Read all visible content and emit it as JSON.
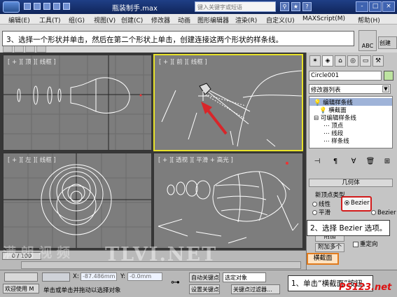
{
  "titlebar": {
    "title": "瓶装制手.max",
    "search_placeholder": "键入关键字或短语",
    "window_buttons": [
      "-",
      "□",
      "×"
    ]
  },
  "menu": [
    "编辑(E)",
    "工具(T)",
    "组(G)",
    "视图(V)",
    "创建(C)",
    "修改器",
    "动画",
    "图形编辑器",
    "渲染(R)",
    "自定义(U)",
    "MAXScript(M)",
    "帮助(H)"
  ],
  "caption": "3、选择一个形状并单击，然后在第二个形状上单击，创建连接这两个形状的样条线。",
  "toolbar": {
    "abc_label": "ABC",
    "create_label": "创建"
  },
  "viewports": {
    "top": "[ + ][ 顶 ][ 线框 ]",
    "front": "[ + ][ 前 ][ 线框 ]",
    "left": "[ + ][ 左 ][ 线框 ]",
    "perspective": "[ + ][ 透视 ][ 平滑 + 高光 ]"
  },
  "panel": {
    "object_name": "Circle001",
    "object_color": "#bde3a0",
    "modifier_list": "修改器列表",
    "stack": [
      "编辑样条线",
      "横截面",
      "可编辑样条线",
      "顶点",
      "线段",
      "样条线"
    ],
    "rollout_title": "几何体",
    "new_vertex_type_label": "新顶点类型",
    "radio_linear": "线性",
    "radio_bezier": "Bezier",
    "radio_smooth": "平滑",
    "radio_bezier_corner": "Bezier 角点",
    "attach_button": "附加",
    "attach_multi_button": "附加多个",
    "reorient_label": "重定向",
    "cross_section_button": "横截面"
  },
  "callouts": {
    "step2": "2、选择 Bezier 选项。",
    "step1": "1、单击“横截面”按钮。"
  },
  "timeline": {
    "frame": "0 / 100"
  },
  "status": {
    "welcome": "欢迎使用 M",
    "hint": "单击或单击并拖动以选择对象",
    "x_label": "X:",
    "x_value": "-87.486mm",
    "y_label": "Y:",
    "y_value": "-0.0mm",
    "auto_key": "自动关键点",
    "set_key": "设置关键点",
    "selected_object": "选定对象",
    "key_filter": "关键点过滤器..."
  },
  "watermark": "TLVI.NET",
  "watermark_cn": "满 朗 视 频",
  "site_logo": "PS123.net"
}
